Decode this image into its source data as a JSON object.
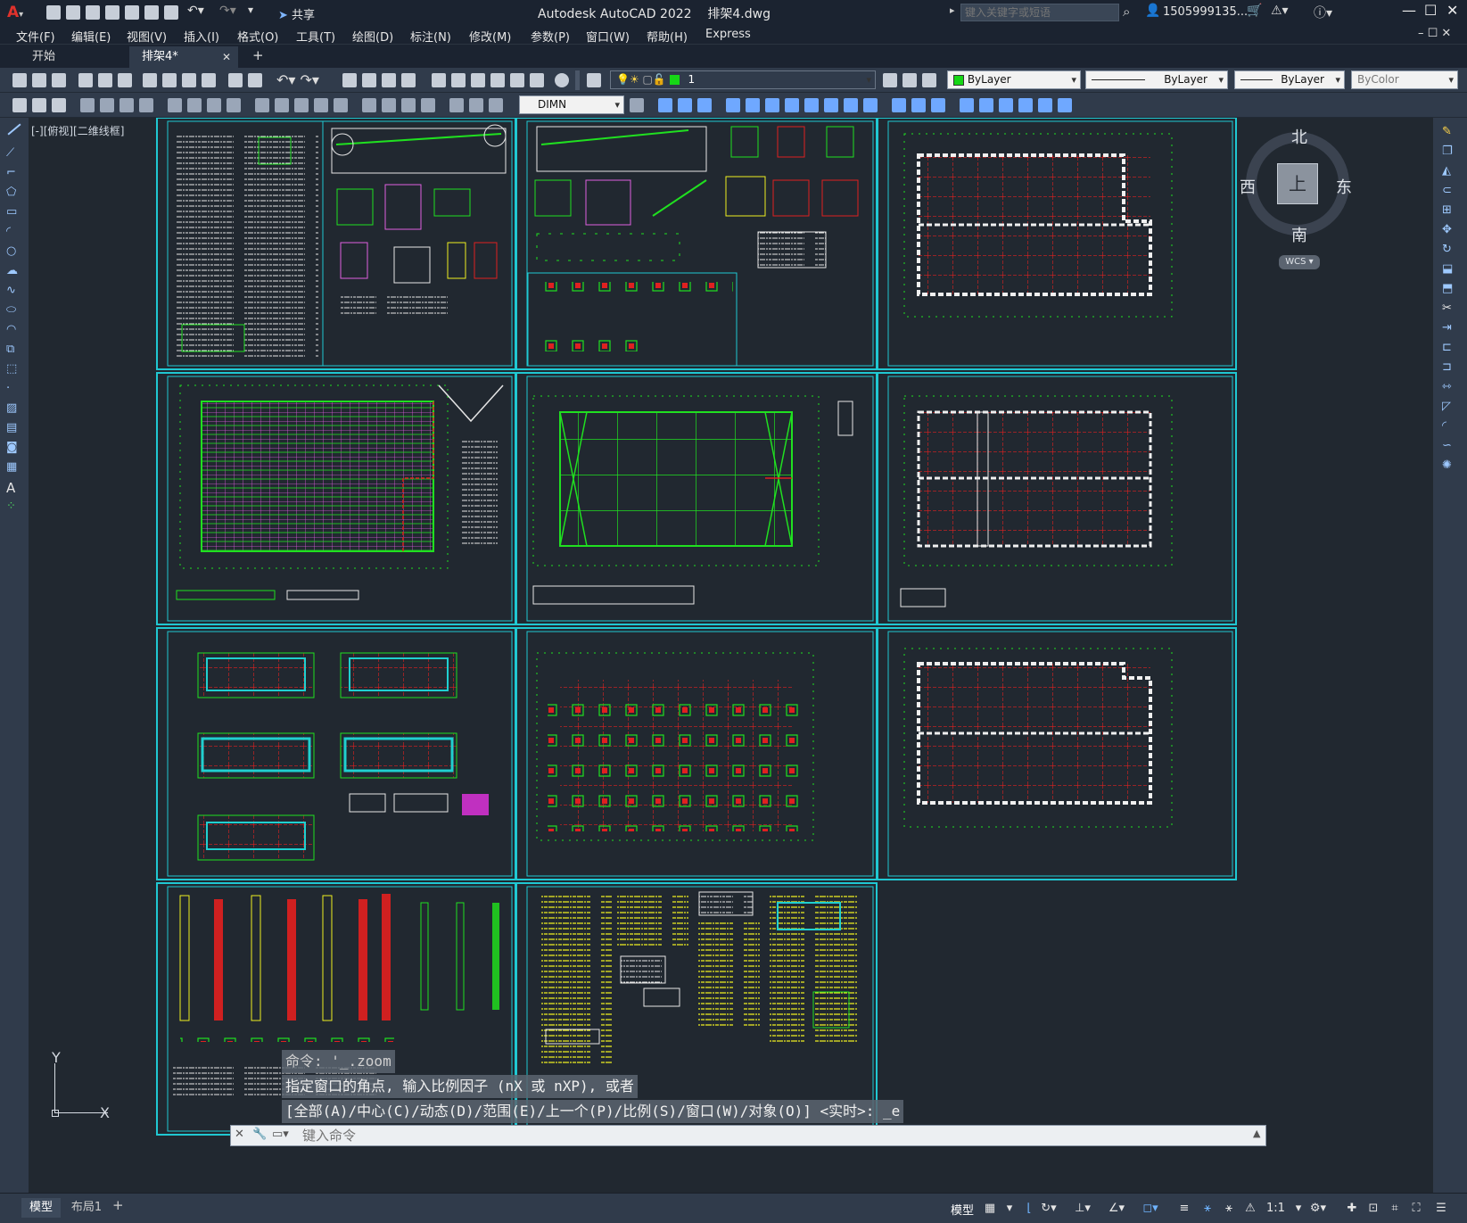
{
  "titlebar": {
    "app_title": "Autodesk AutoCAD 2022",
    "file_name": "排架4.dwg",
    "share_label": "共享",
    "search_placeholder": "键入关键字或短语",
    "user": "1505999135..."
  },
  "menu": [
    "文件(F)",
    "编辑(E)",
    "视图(V)",
    "插入(I)",
    "格式(O)",
    "工具(T)",
    "绘图(D)",
    "标注(N)",
    "修改(M)",
    "参数(P)",
    "窗口(W)",
    "帮助(H)",
    "Express"
  ],
  "tabs": [
    {
      "label": "开始"
    },
    {
      "label": "排架4*"
    }
  ],
  "toolbar": {
    "layer_value": "1",
    "color_value": "ByLayer",
    "linetype_value": "ByLayer",
    "lineweight_value": "ByLayer",
    "plotstyle_value": "ByColor",
    "dimstyle_value": "DIMN"
  },
  "viewport_label": "[-][俯视][二维线框]",
  "viewcube": {
    "north": "北",
    "south": "南",
    "east": "东",
    "west": "西",
    "top": "上",
    "wcs": "WCS"
  },
  "ucs": {
    "x": "X",
    "y": "Y"
  },
  "command": {
    "history1": "命令: '_.zoom",
    "history2": "指定窗口的角点, 输入比例因子 (nX 或 nXP), 或者",
    "history3": "[全部(A)/中心(C)/动态(D)/范围(E)/上一个(P)/比例(S)/窗口(W)/对象(O)] <实时>: _e",
    "input_placeholder": "键入命令"
  },
  "layout_tabs": [
    "模型",
    "布局1"
  ],
  "status": {
    "model": "模型",
    "scale": "1:1"
  },
  "colors": {
    "frame": "#20c8d2",
    "grid_red": "#e02020",
    "grid_green": "#20e020",
    "text_yellow": "#f0f020",
    "bg": "#212830"
  }
}
